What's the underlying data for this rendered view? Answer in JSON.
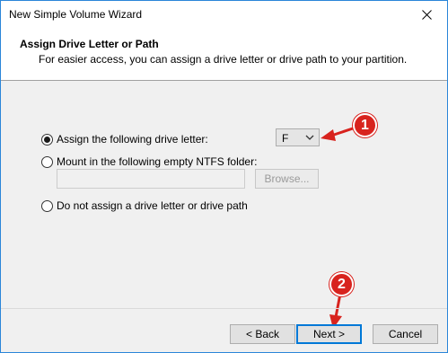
{
  "window": {
    "title": "New Simple Volume Wizard"
  },
  "header": {
    "title": "Assign Drive Letter or Path",
    "subtitle": "For easier access, you can assign a drive letter or drive path to your partition."
  },
  "options": {
    "assign_letter": {
      "label": "Assign the following drive letter:",
      "selected": true
    },
    "mount_folder": {
      "label": "Mount in the following empty NTFS folder:",
      "selected": false
    },
    "no_letter": {
      "label": "Do not assign a drive letter or drive path",
      "selected": false
    }
  },
  "drive_letter": {
    "value": "F"
  },
  "folder_path": {
    "value": ""
  },
  "browse_label": "Browse...",
  "buttons": {
    "back": "< Back",
    "next": "Next >",
    "cancel": "Cancel"
  },
  "callouts": {
    "one": "1",
    "two": "2"
  },
  "colors": {
    "callout": "#d8231e",
    "focus_border": "#0078d7"
  }
}
